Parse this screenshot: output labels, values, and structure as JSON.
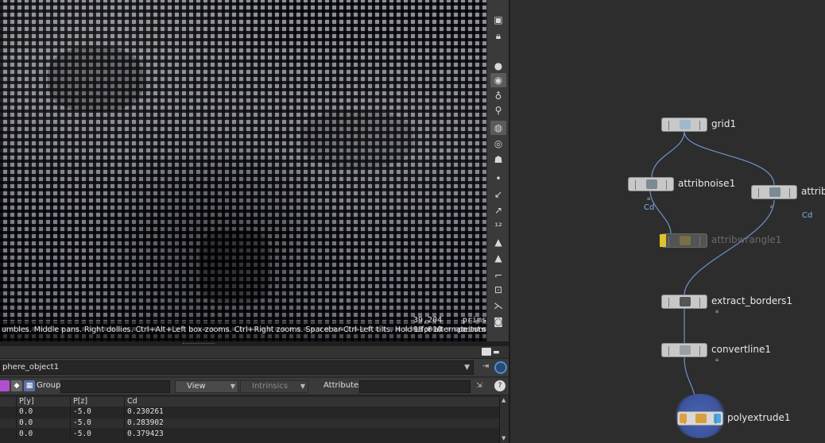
{
  "viewport": {
    "status_hint": "umbles. Middle pans. Right dollies. Ctrl+Alt+Left box-zooms. Ctrl+Right zooms. Spacebar-Ctrl-Left tilts. Hold L for alternate tumble, dolly, and zoom.",
    "stats": [
      {
        "value": "39,204",
        "label": "prims"
      },
      {
        "value": "98,010",
        "label": "points"
      }
    ]
  },
  "toolbar_icons": [
    "display-icon",
    "lock-icon",
    "shading-icon",
    "light-icon",
    "camera-icon",
    "visibility-icon",
    "snap-icon",
    "point-icon",
    "normal-icon",
    "number-icon",
    "brush-icon",
    "paint-icon",
    "frame-icon",
    "transform-icon",
    "handle-icon",
    "record-icon"
  ],
  "spreadsheet": {
    "path": "phere_object1",
    "group_label": "Group:",
    "view_label": "View",
    "intrinsics_label": "Intrinsics",
    "attributes_label": "Attributes:",
    "columns": [
      "P[y]",
      "P[z]",
      "Cd"
    ],
    "rows": [
      [
        "0.0",
        "-5.0",
        "0.230261"
      ],
      [
        "0.0",
        "-5.0",
        "0.283902"
      ],
      [
        "0.0",
        "-5.0",
        "0.379423"
      ]
    ]
  },
  "network": {
    "nodes": [
      {
        "label": "grid1"
      },
      {
        "label": "attribnoise1",
        "sub": "Cd"
      },
      {
        "label": "attrib",
        "sub": "Cd"
      },
      {
        "label": "attribwrangle1"
      },
      {
        "label": "extract_borders1"
      },
      {
        "label": "convertline1"
      },
      {
        "label": "polyextrude1"
      }
    ]
  }
}
